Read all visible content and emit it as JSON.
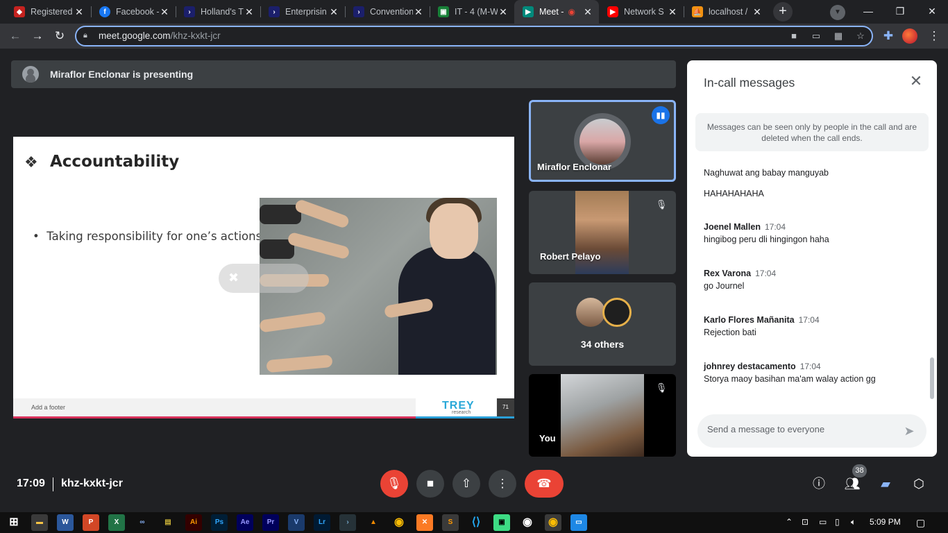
{
  "browser": {
    "tabs": [
      {
        "title": "Registered",
        "favicon": "shield-icon",
        "color": "#c5221f"
      },
      {
        "title": "Facebook -",
        "favicon": "facebook-icon",
        "color": "#1877f2"
      },
      {
        "title": "Holland's T",
        "favicon": "moodle-icon",
        "color": "#1b1f6b"
      },
      {
        "title": "Enterprisin",
        "favicon": "moodle-icon",
        "color": "#1b1f6b"
      },
      {
        "title": "Convention",
        "favicon": "moodle-icon",
        "color": "#1b1f6b"
      },
      {
        "title": "IT - 4 (M-W",
        "favicon": "classroom-icon",
        "color": "#188038"
      },
      {
        "title": "Meet -",
        "favicon": "meet-icon",
        "color": "#00897b",
        "active": true
      },
      {
        "title": "Network S",
        "favicon": "youtube-icon",
        "color": "#ff0000"
      },
      {
        "title": "localhost /",
        "favicon": "phpmyadmin-icon",
        "color": "#f29111"
      }
    ],
    "url_host": "meet.google.com",
    "url_path": "/khz-kxkt-jcr"
  },
  "meet": {
    "presenting_text": "Miraflor Enclonar is presenting",
    "slide": {
      "title": "Accountability",
      "bullet": "Taking responsibility for one’s actions.",
      "footer": "Add a footer",
      "logo_main": "TREY",
      "logo_sub": "research",
      "page": "71"
    },
    "participants": [
      {
        "name": "Miraflor Enclonar",
        "speaking": true
      },
      {
        "name": "Robert Pelayo",
        "muted": true
      },
      {
        "name": "34 others"
      },
      {
        "name": "You",
        "muted": true
      }
    ],
    "chat": {
      "title": "In-call messages",
      "notice": "Messages can be seen only by people in the call and are deleted when the call ends.",
      "messages": [
        {
          "sender": "",
          "time": "",
          "text": "Naghuwat ang babay manguyab"
        },
        {
          "sender": "",
          "time": "",
          "text": "HAHAHAHAHA"
        },
        {
          "sender": "Joenel Mallen",
          "time": "17:04",
          "text": "hingibog peru dli hingingon haha"
        },
        {
          "sender": "Rex Varona",
          "time": "17:04",
          "text": "go Journel"
        },
        {
          "sender": "Karlo Flores Mañanita",
          "time": "17:04",
          "text": "Rejection bati"
        },
        {
          "sender": "johnrey destacamento",
          "time": "17:04",
          "text": "Storya maoy basihan ma'am walay action gg"
        }
      ],
      "input_placeholder": "Send a message to everyone"
    },
    "bottom": {
      "time": "17:09",
      "meeting_code": "khz-kxkt-jcr",
      "people_count": "38"
    }
  },
  "taskbar": {
    "time": "5:09 PM"
  }
}
